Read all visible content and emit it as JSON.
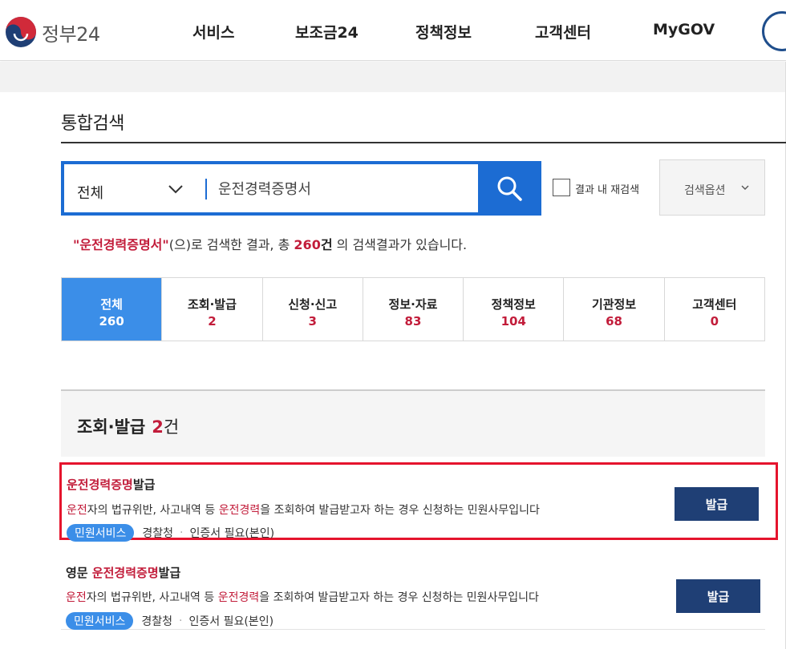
{
  "brand": {
    "name": "정부24"
  },
  "nav": {
    "items": [
      "서비스",
      "보조금24",
      "정책정보",
      "고객센터",
      "MyGOV"
    ]
  },
  "page": {
    "title": "통합검색"
  },
  "search": {
    "category": "전체",
    "query": "운전경력증명서",
    "recheck_label": "결과 내 재검색",
    "options_label": "검색옵션"
  },
  "summary": {
    "quote_open": "\"",
    "keyword": "운전경력증명서",
    "quote_close": "\"",
    "text1": "(으)로 검색한 결과, 총 ",
    "total": "260",
    "unit": "건",
    "text2": " 의 검색결과가 있습니다."
  },
  "tabs": [
    {
      "label": "전체",
      "count": "260"
    },
    {
      "label": "조회·발급",
      "count": "2"
    },
    {
      "label": "신청·신고",
      "count": "3"
    },
    {
      "label": "정보·자료",
      "count": "83"
    },
    {
      "label": "정책정보",
      "count": "104"
    },
    {
      "label": "기관정보",
      "count": "68"
    },
    {
      "label": "고객센터",
      "count": "0"
    }
  ],
  "section": {
    "title": "조회·발급",
    "count": "2",
    "unit": "건"
  },
  "results": [
    {
      "title_prefix": "",
      "title_hl": "운전경력증명",
      "title_rest": "발급",
      "desc_hl1": "운전",
      "desc_mid": "자의 법규위반, 사고내역 등 ",
      "desc_hl2": "운전경력",
      "desc_rest": "을 조회하여 발급받고자 하는 경우 신청하는 민원사무입니다",
      "badge": "민원서비스",
      "agency": "경찰청",
      "auth": "인증서 필요(본인)",
      "button": "발급"
    },
    {
      "title_prefix": "영문 ",
      "title_hl": "운전경력증명",
      "title_rest": "발급",
      "desc_hl1": "운전",
      "desc_mid": "자의 법규위반, 사고내역 등 ",
      "desc_hl2": "운전경력",
      "desc_rest": "을 조회하여 발급받고자 하는 경우 신청하는 민원사무입니다",
      "badge": "민원서비스",
      "agency": "경찰청",
      "auth": "인증서 필요(본인)",
      "button": "발급"
    }
  ],
  "colors": {
    "accent_blue": "#1c6cd3",
    "tab_active": "#3b8ee8",
    "highlight_red": "#c21c3a",
    "button_navy": "#1f3f75",
    "selection_border": "#e5142d"
  },
  "icons": [
    "government-logo-icon",
    "chevron-down-icon",
    "search-icon",
    "profile-circle-icon"
  ]
}
